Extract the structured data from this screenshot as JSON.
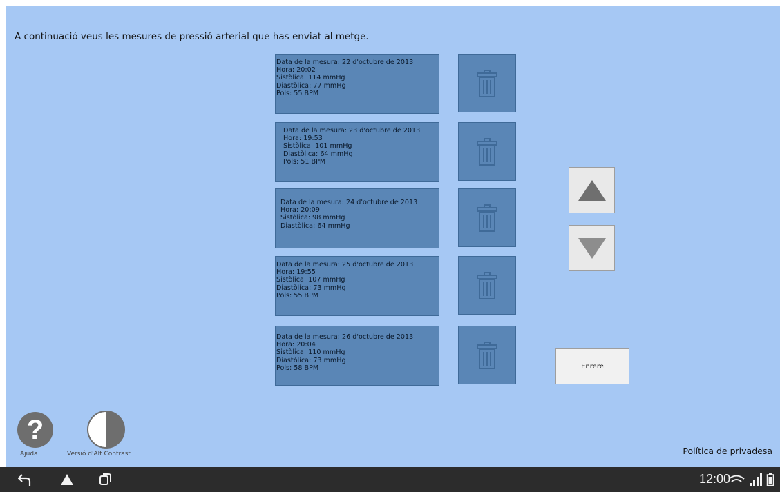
{
  "intro_text": "A continuació veus les mesures de pressió arterial que has enviat al metge.",
  "measurements": [
    {
      "date": "Data de la mesura:  22 d'octubre de 2013",
      "time": "Hora: 20:02",
      "systolic": "Sistòlica: 114 mmHg",
      "diastolic": "Diastòlica: 77 mmHg",
      "pulse": "Pols: 55 BPM"
    },
    {
      "date": "Data de la mesura:  23 d'octubre de 2013",
      "time": "Hora: 19:53",
      "systolic": "Sistòlica: 101 mmHg",
      "diastolic": "Diastòlica: 64 mmHg",
      "pulse": "Pols: 51 BPM"
    },
    {
      "date": "Data de la mesura:  24 d'octubre de 2013",
      "time": "Hora: 20:09",
      "systolic": "Sistòlica: 98 mmHg",
      "diastolic": "Diastòlica: 64 mmHg",
      "pulse": ""
    },
    {
      "date": "Data de la mesura:  25 d'octubre de 2013",
      "time": "Hora: 19:55",
      "systolic": "Sistòlica: 107 mmHg",
      "diastolic": "Diastòlica: 73 mmHg",
      "pulse": "Pols: 55 BPM"
    },
    {
      "date": "Data de la mesura:  26 d'octubre de 2013",
      "time": "Hora: 20:04",
      "systolic": "Sistòlica: 110 mmHg",
      "diastolic": "Diastòlica: 73 mmHg",
      "pulse": "Pols: 58 BPM"
    }
  ],
  "icons": {
    "delete": "trash-icon",
    "scroll_up": "arrow-up-icon",
    "scroll_down": "arrow-down-icon",
    "help": "help-icon",
    "contrast": "contrast-icon",
    "nav_back": "back-icon",
    "nav_home": "home-icon",
    "nav_recents": "recents-icon",
    "wifi": "wifi-icon",
    "signal": "signal-icon",
    "battery": "battery-icon"
  },
  "back_button_label": "Enrere",
  "help_label": "Ajuda",
  "contrast_label": "Versió d'Alt Contrast",
  "privacy_link": "Política de privadesa",
  "status_bar": {
    "time": "12:00"
  },
  "colors": {
    "background": "#a6c8f4",
    "card": "#5a86b6",
    "navbar": "#2c2c2c"
  }
}
